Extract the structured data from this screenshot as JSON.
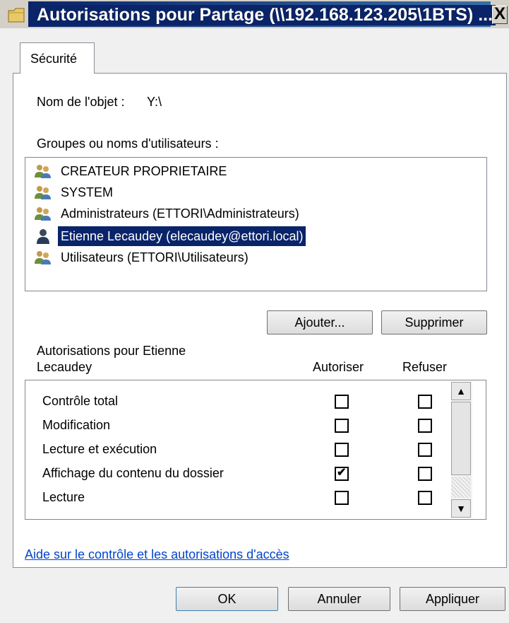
{
  "window": {
    "title": "Autorisations pour Partage (\\\\192.168.123.205\\1BTS) ...",
    "close_glyph": "X"
  },
  "tabs": [
    {
      "label": "Sécurité",
      "active": true
    }
  ],
  "object": {
    "label": "Nom de l'objet :",
    "value": "Y:\\"
  },
  "groups": {
    "label": "Groupes ou noms d'utilisateurs :",
    "items": [
      {
        "label": "CREATEUR PROPRIETAIRE",
        "icon": "group-icon",
        "selected": false
      },
      {
        "label": "SYSTEM",
        "icon": "group-icon",
        "selected": false
      },
      {
        "label": "Administrateurs (ETTORI\\Administrateurs)",
        "icon": "group-icon",
        "selected": false
      },
      {
        "label": "Etienne Lecaudey (elecaudey@ettori.local)",
        "icon": "user-icon",
        "selected": true
      },
      {
        "label": "Utilisateurs (ETTORI\\Utilisateurs)",
        "icon": "group-icon",
        "selected": false
      }
    ]
  },
  "buttons": {
    "add": "Ajouter...",
    "remove": "Supprimer",
    "ok": "OK",
    "cancel": "Annuler",
    "apply": "Appliquer"
  },
  "permissions": {
    "title_line1": "Autorisations pour Etienne",
    "title_line2": "Lecaudey",
    "col_allow": "Autoriser",
    "col_deny": "Refuser",
    "rows": [
      {
        "name": "Contrôle total",
        "allow": false,
        "deny": false
      },
      {
        "name": "Modification",
        "allow": false,
        "deny": false
      },
      {
        "name": "Lecture et exécution",
        "allow": false,
        "deny": false
      },
      {
        "name": "Affichage du contenu du dossier",
        "allow": true,
        "deny": false
      },
      {
        "name": "Lecture",
        "allow": false,
        "deny": false
      }
    ]
  },
  "help_link": "Aide sur le contrôle et les autorisations d'accès",
  "colors": {
    "selection": "#0a246a",
    "link": "#0044cc",
    "title_bar": "#0a246a"
  }
}
